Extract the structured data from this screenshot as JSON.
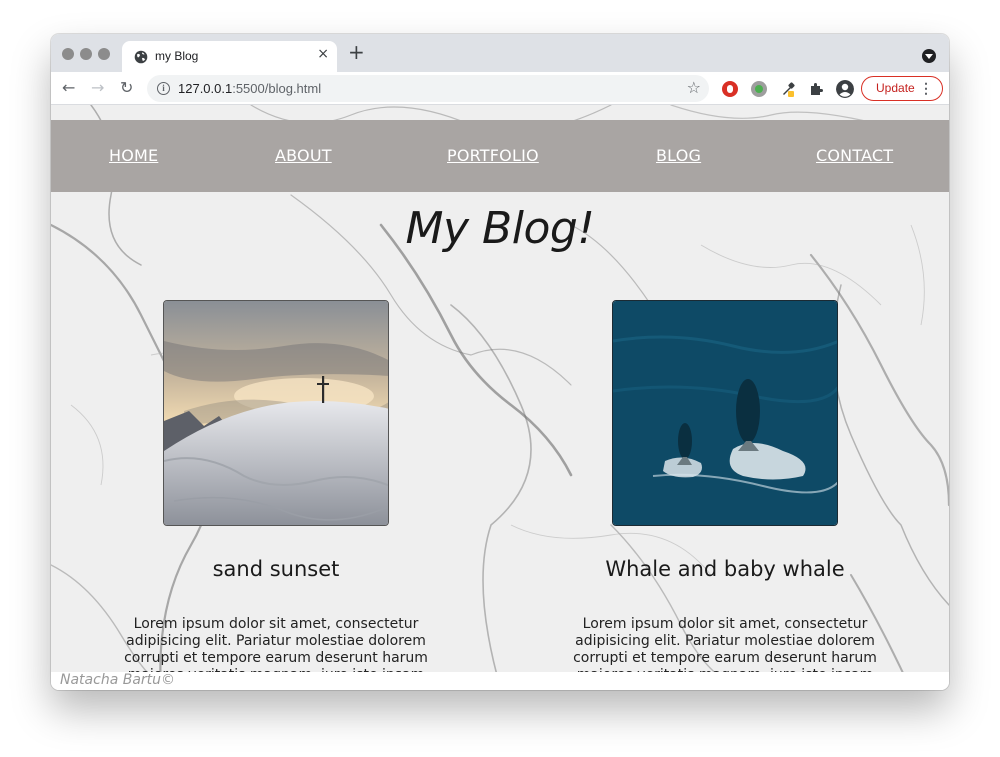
{
  "browser": {
    "tab_title": "my Blog",
    "tab_close": "×",
    "new_tab": "+",
    "url_host": "127.0.0.1",
    "url_rest": ":5500/blog.html",
    "update_label": "Update",
    "menu_glyph": "⋮",
    "back_glyph": "←",
    "forward_glyph": "→",
    "reload_glyph": "↻",
    "star_glyph": "☆",
    "info_glyph": "i"
  },
  "nav": {
    "items": [
      {
        "label": "HOME"
      },
      {
        "label": "ABOUT"
      },
      {
        "label": "PORTFOLIO"
      },
      {
        "label": "BLOG"
      },
      {
        "label": "CONTACT"
      }
    ]
  },
  "page": {
    "title": "My Blog!"
  },
  "posts": [
    {
      "title": "sand sunset",
      "body": "Lorem ipsum dolor sit amet, consectetur adipisicing elit. Pariatur molestiae dolorem corrupti et tempore earum deserunt harum maiores veritatis magnam, iure iste ipsam exercitationem ad quod in inventore unde accusamus!",
      "image": "mountain-summit-cross-photo"
    },
    {
      "title": "Whale and baby whale",
      "body": "Lorem ipsum dolor sit amet, consectetur adipisicing elit. Pariatur molestiae dolorem corrupti et tempore earum deserunt harum maiores veritatis magnam, iure iste ipsam exercitationem ad quod in inventore unde accusamus!",
      "image": "whales-ocean-photo"
    }
  ],
  "footer": {
    "text": "Natacha Bartu©"
  },
  "colors": {
    "navbar": "#a9a5a3",
    "update_red": "#d93025",
    "ocean": "#0e4a66"
  }
}
